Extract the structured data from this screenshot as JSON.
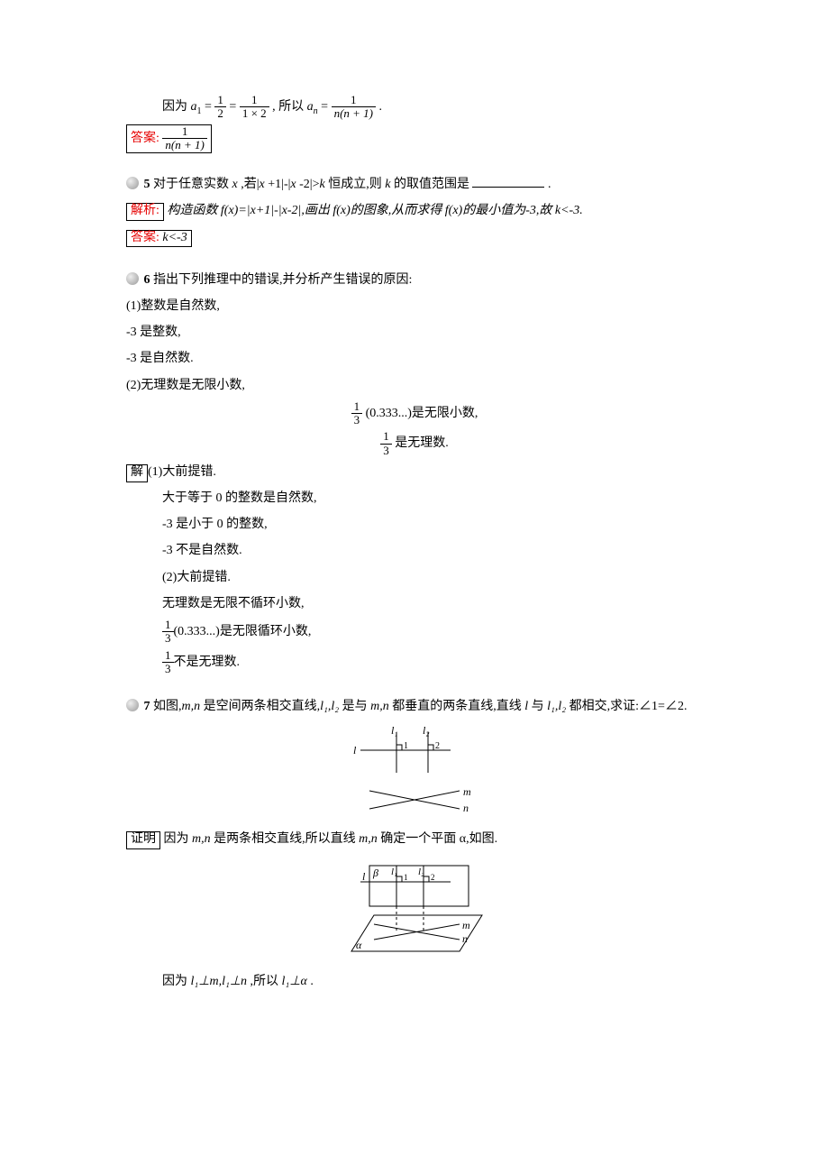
{
  "p1_prefix": "因为 ",
  "p1_a1": "a",
  "p1_sub1": "1",
  "p1_eq": " = ",
  "p1_f1n": "1",
  "p1_f1d": "2",
  "p1_eq2": " = ",
  "p1_f2n": "1",
  "p1_f2d": "1 × 2",
  "p1_mid": ", 所以",
  "p1_an": "a",
  "p1_subn": "n",
  "p1_eq3": " = ",
  "p1_f3n": "1",
  "p1_f3d": "n(n + 1)",
  "p1_suffix": ".",
  "ans1_label": "答案:",
  "ans1_fn": "1",
  "ans1_fd": "n(n + 1)",
  "q5_num": "5",
  "q5_text_a": " 对于任意实数 ",
  "q5_x": "x",
  "q5_text_b": ",若|",
  "q5_x2": "x",
  "q5_text_c": "+1|-|",
  "q5_x3": "x",
  "q5_text_d": "-2|>",
  "q5_k": "k",
  "q5_text_e": " 恒成立,则 ",
  "q5_k2": "k",
  "q5_text_f": " 的取值范围是",
  "q5_period": ".",
  "jiexi_label": "解析:",
  "jiexi_text": "构造函数 f(x)=|x+1|-|x-2|,画出 f(x)的图象,从而求得 f(x)的最小值为-3,故 k<-3.",
  "ans2_label": "答案:",
  "ans2_text": "k<-3",
  "q6_num": "6",
  "q6_text": " 指出下列推理中的错误,并分析产生错误的原因:",
  "q6_1": "(1)整数是自然数,",
  "q6_2": "-3 是整数,",
  "q6_3": "-3 是自然数.",
  "q6_4": "(2)无理数是无限小数,",
  "q6_cfrac_n": "1",
  "q6_cfrac_d": "3",
  "q6_c1_tail": " (0.333...)是无限小数,",
  "q6_c2_tail": " 是无理数.",
  "jie_label": "解",
  "jie_1": "(1)大前提错.",
  "jie_2": "大于等于 0 的整数是自然数,",
  "jie_3": "-3 是小于 0 的整数,",
  "jie_4": "-3 不是自然数.",
  "jie_5": "(2)大前提错.",
  "jie_6": "无理数是无限不循环小数,",
  "jie_7_tail": "(0.333...)是无限循环小数,",
  "jie_8_tail": "不是无理数.",
  "q7_num": "7",
  "q7_a": " 如图,",
  "q7_mn": "m,n",
  "q7_b": " 是空间两条相交直线,",
  "q7_l12": "l₁,l₂",
  "q7_c": " 是与 ",
  "q7_mn2": "m,n",
  "q7_d": " 都垂直的两条直线,直线 ",
  "q7_l": "l",
  "q7_e": " 与 ",
  "q7_l122": "l₁,l₂",
  "q7_f": " 都相交,求证:∠1=∠2.",
  "svg1": {
    "l": "l",
    "l1": "l₁",
    "l2": "l₂",
    "a1": "1",
    "a2": "2",
    "m": "m",
    "n": "n"
  },
  "zm_label": "证明",
  "zm_text_a": "因为 ",
  "zm_mn": "m,n",
  "zm_text_b": " 是两条相交直线,所以直线 ",
  "zm_mn2": "m,n",
  "zm_text_c": " 确定一个平面 α,如图.",
  "svg2": {
    "beta": "β",
    "l": "l",
    "l1": "l₁",
    "l2": "l₂",
    "a1": "1",
    "a2": "2",
    "m": "m",
    "n": "n",
    "alpha": "α"
  },
  "last_a": "因为 ",
  "last_l1m": "l₁⊥m,l₁⊥n",
  "last_b": ",所以 ",
  "last_l1a": "l₁⊥α",
  "last_c": "."
}
